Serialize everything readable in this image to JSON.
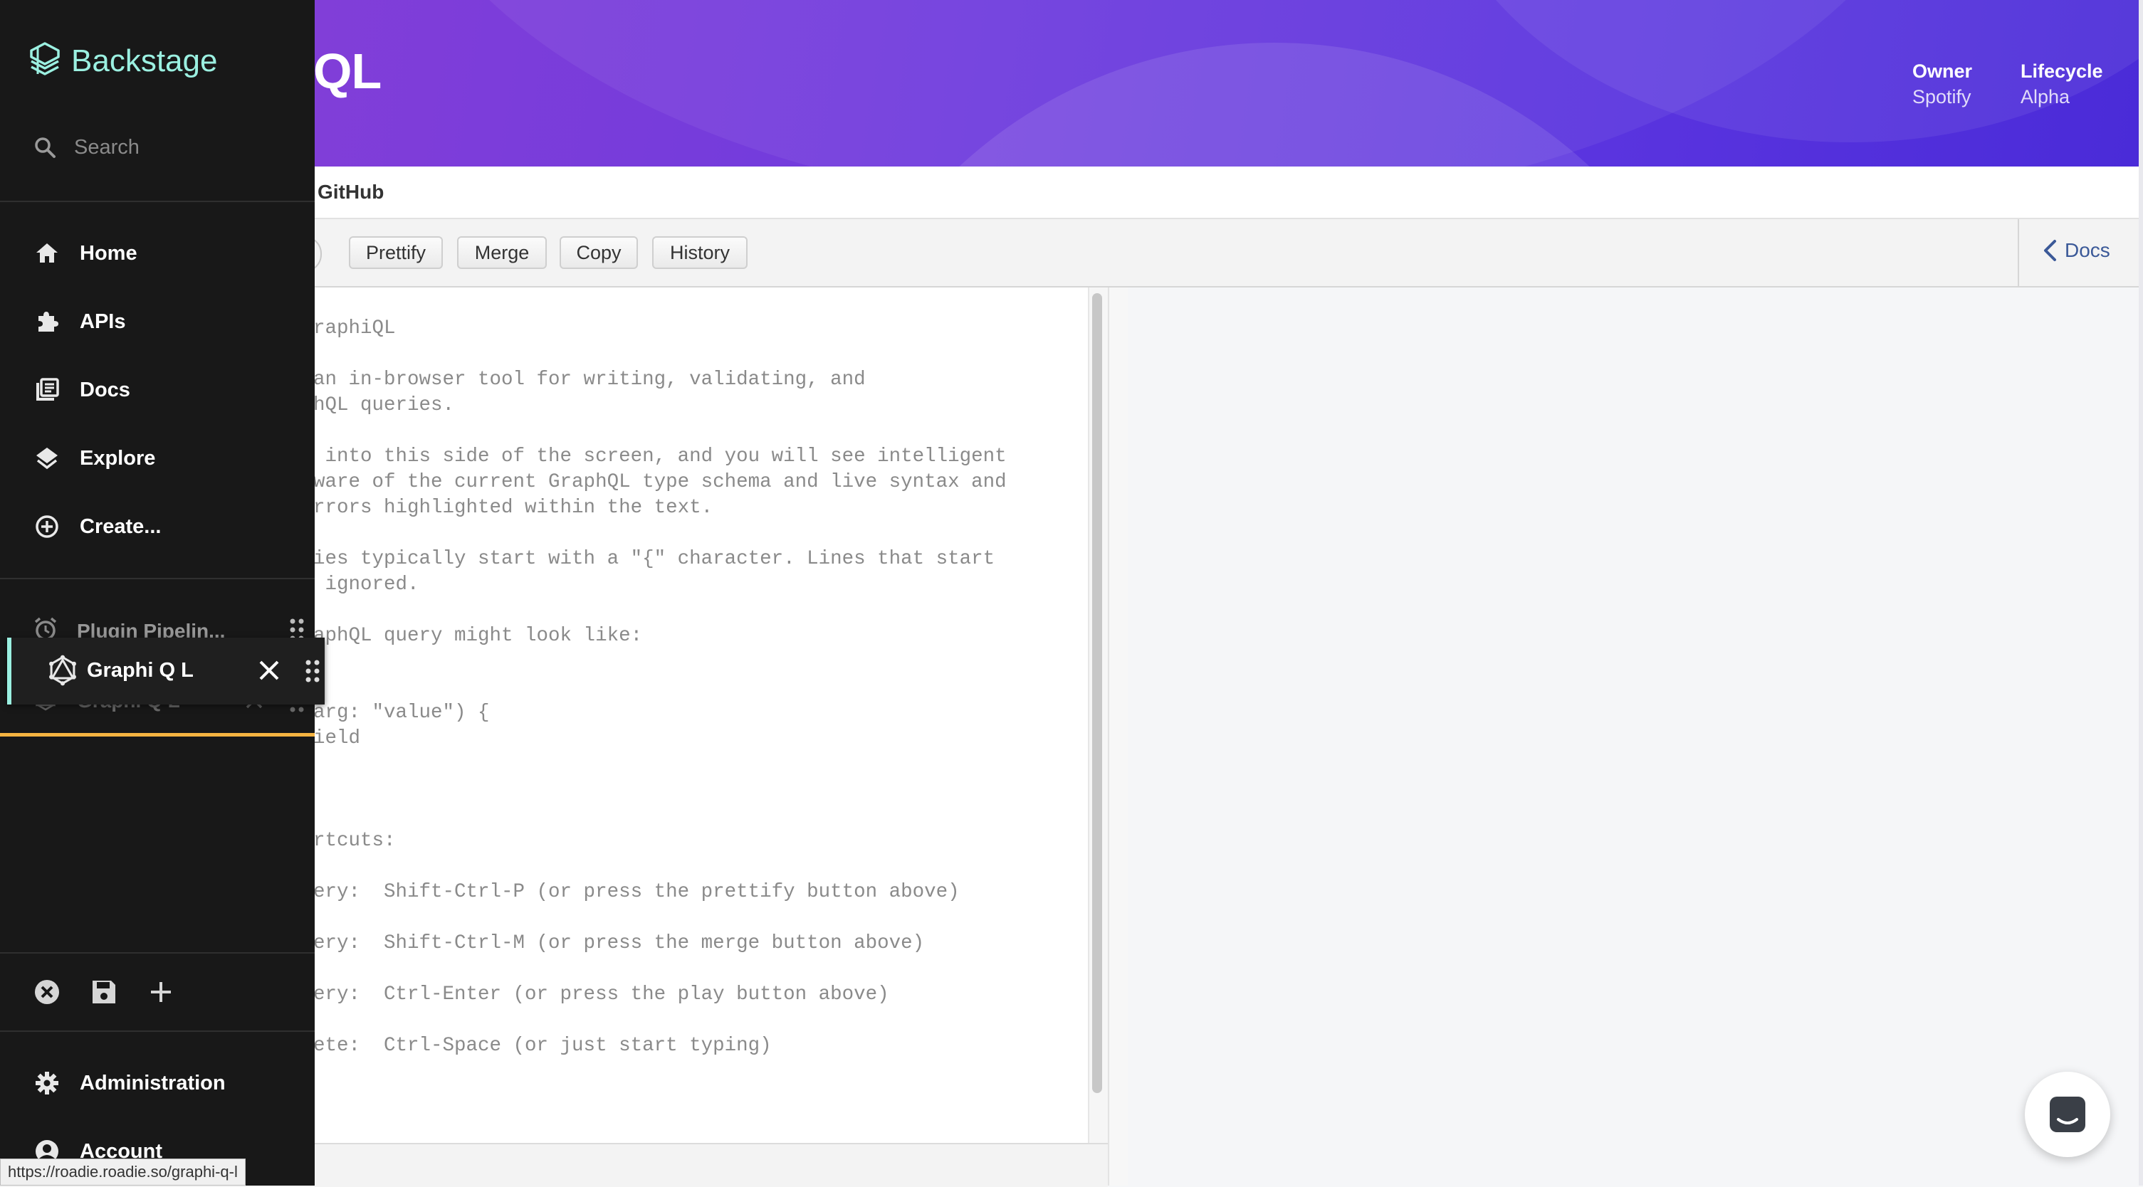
{
  "header": {
    "title_fragment": "QL",
    "owner_label": "Owner",
    "owner_value": "Spotify",
    "lifecycle_label": "Lifecycle",
    "lifecycle_value": "Alpha"
  },
  "tabs": {
    "github": "GitHub"
  },
  "toolbar": {
    "buttons": [
      "Prettify",
      "Merge",
      "Copy",
      "History"
    ],
    "docs": "Docs"
  },
  "editor": {
    "lines": [
      "raphiQL",
      "",
      "an in-browser tool for writing, validating, and",
      "hQL queries.",
      "",
      " into this side of the screen, and you will see intelligent",
      "ware of the current GraphQL type schema and live syntax and",
      "rrors highlighted within the text.",
      "",
      "ies typically start with a \"{\" character. Lines that start",
      " ignored.",
      "",
      "aphQL query might look like:",
      "",
      "",
      "arg: \"value\") {",
      "ield",
      "",
      "",
      "",
      "rtcuts:",
      "",
      "ery:  Shift-Ctrl-P (or press the prettify button above)",
      "",
      "ery:  Shift-Ctrl-M (or press the merge button above)",
      "",
      "ery:  Ctrl-Enter (or press the play button above)",
      "",
      "ete:  Ctrl-Space (or just start typing)"
    ]
  },
  "sidebar": {
    "brand": "Backstage",
    "search_placeholder": "Search",
    "nav": {
      "home": "Home",
      "apis": "APIs",
      "docs": "Docs",
      "explore": "Explore",
      "create": "Create..."
    },
    "shortcuts": {
      "plugin_pipelines": "Plugin Pipelin...",
      "graphiql_drag": "Graphi Q L",
      "graphiql_ghost": "Graphi Q L"
    },
    "administration": "Administration",
    "account": "Account"
  },
  "status_url": "https://roadie.roadie.so/graphi-q-l",
  "colors": {
    "brand_accent": "#9bf0e1",
    "drop_indicator": "#f5b341",
    "header_start": "#8a3fd6",
    "header_end": "#4a2bd8"
  }
}
